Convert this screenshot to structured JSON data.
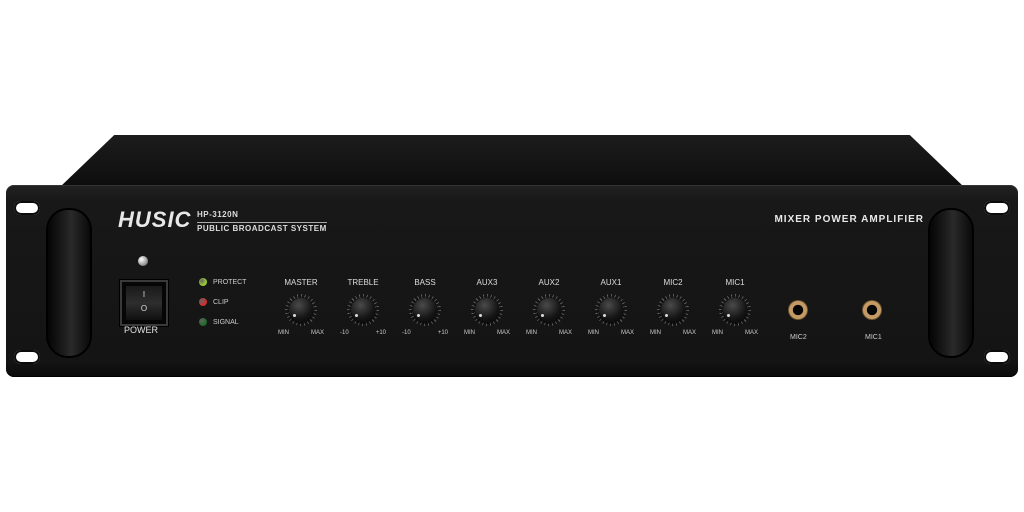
{
  "brand": "HUSIC",
  "model": "HP-3120N",
  "subtitle": "PUBLIC BROADCAST SYSTEM",
  "heading": "MIXER POWER AMPLIFIER",
  "power": {
    "label": "POWER",
    "on_symbol": "I",
    "off_symbol": "O"
  },
  "indicators": [
    {
      "label": "PROTECT",
      "color": "#9acd32"
    },
    {
      "label": "CLIP",
      "color": "#d03030"
    },
    {
      "label": "SIGNAL",
      "color": "#1f6a2a"
    }
  ],
  "knobs": [
    {
      "name": "MASTER",
      "min": "MIN",
      "max": "MAX"
    },
    {
      "name": "TREBLE",
      "min": "-10",
      "max": "+10"
    },
    {
      "name": "BASS",
      "min": "-10",
      "max": "+10"
    },
    {
      "name": "AUX3",
      "min": "MIN",
      "max": "MAX"
    },
    {
      "name": "AUX2",
      "min": "MIN",
      "max": "MAX"
    },
    {
      "name": "AUX1",
      "min": "MIN",
      "max": "MAX"
    },
    {
      "name": "MIC2",
      "min": "MIN",
      "max": "MAX"
    },
    {
      "name": "MIC1",
      "min": "MIN",
      "max": "MAX"
    }
  ],
  "jacks": [
    {
      "label": "MIC2"
    },
    {
      "label": "MIC1"
    }
  ]
}
